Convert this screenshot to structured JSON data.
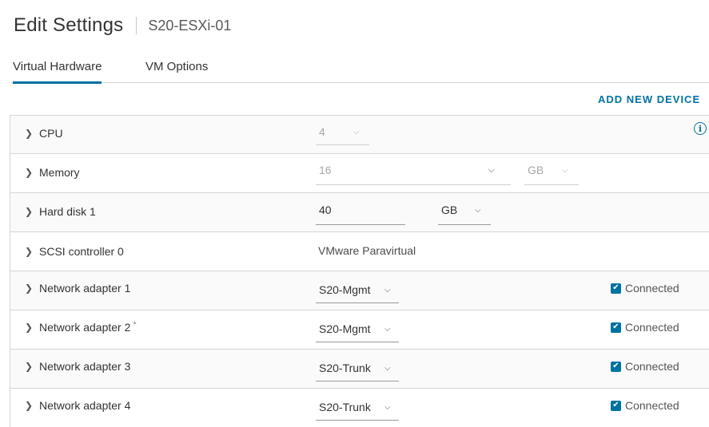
{
  "header": {
    "title": "Edit Settings",
    "vm_name": "S20-ESXi-01"
  },
  "tabs": [
    {
      "label": "Virtual Hardware",
      "active": true
    },
    {
      "label": "VM Options",
      "active": false
    }
  ],
  "add_device_label": "ADD NEW DEVICE",
  "hardware": {
    "cpu": {
      "label": "CPU",
      "value": "4"
    },
    "memory": {
      "label": "Memory",
      "value": "16",
      "unit": "GB"
    },
    "hard_disk": {
      "label": "Hard disk 1",
      "value": "40",
      "unit": "GB"
    },
    "scsi": {
      "label": "SCSI controller 0",
      "value": "VMware Paravirtual"
    },
    "network_adapters": [
      {
        "label": "Network adapter 1",
        "modified_mark": "",
        "network": "S20-Mgmt",
        "connected_label": "Connected",
        "connected": true
      },
      {
        "label": "Network adapter 2",
        "modified_mark": "*",
        "network": "S20-Mgmt",
        "connected_label": "Connected",
        "connected": true
      },
      {
        "label": "Network adapter 3",
        "modified_mark": "",
        "network": "S20-Trunk",
        "connected_label": "Connected",
        "connected": true
      },
      {
        "label": "Network adapter 4",
        "modified_mark": "",
        "network": "S20-Trunk",
        "connected_label": "Connected",
        "connected": true
      }
    ]
  },
  "colors": {
    "accent": "#0072a3",
    "border": "#d6d6d6",
    "text": "#333333"
  }
}
